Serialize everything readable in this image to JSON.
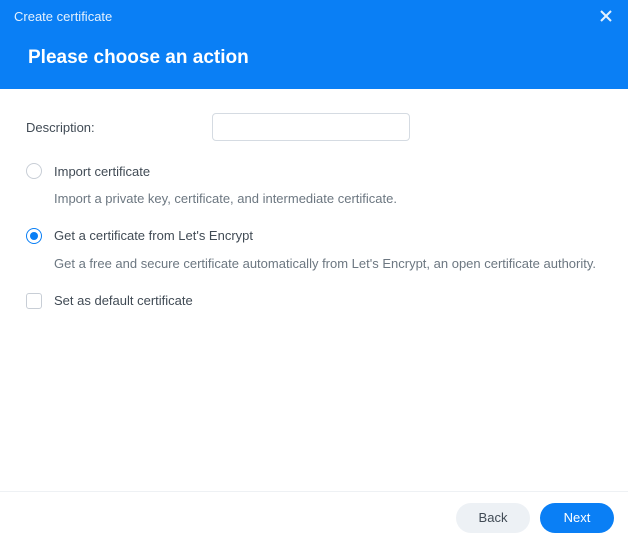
{
  "header": {
    "title": "Create certificate",
    "subtitle": "Please choose an action"
  },
  "form": {
    "description_label": "Description:",
    "description_value": ""
  },
  "options": {
    "import": {
      "label": "Import certificate",
      "description": "Import a private key, certificate, and intermediate certificate.",
      "selected": false
    },
    "letsencrypt": {
      "label": "Get a certificate from Let's Encrypt",
      "description": "Get a free and secure certificate automatically from Let's Encrypt, an open certificate authority.",
      "selected": true
    }
  },
  "checkbox": {
    "set_default_label": "Set as default certificate",
    "checked": false
  },
  "footer": {
    "back_label": "Back",
    "next_label": "Next"
  },
  "colors": {
    "accent": "#0a7ff5"
  }
}
